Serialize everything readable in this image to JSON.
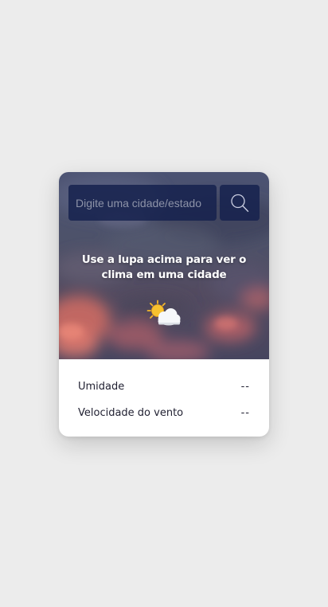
{
  "search": {
    "placeholder": "Digite uma cidade/estado",
    "value": ""
  },
  "icons": {
    "search": "magnifier-icon",
    "weather": "sun-behind-cloud-icon"
  },
  "message": {
    "line1": "Use a lupa acima para ver o",
    "line2": "clima em uma cidade"
  },
  "details": [
    {
      "label": "Umidade",
      "value": "--"
    },
    {
      "label": "Velocidade do vento",
      "value": "--"
    }
  ],
  "colors": {
    "page_background": "#ececec",
    "search_background": "#16224e",
    "sky_dark": "#3e4b68",
    "sky_pink": "#d8736f",
    "card_background": "#ffffff",
    "text_dark": "#222233"
  }
}
